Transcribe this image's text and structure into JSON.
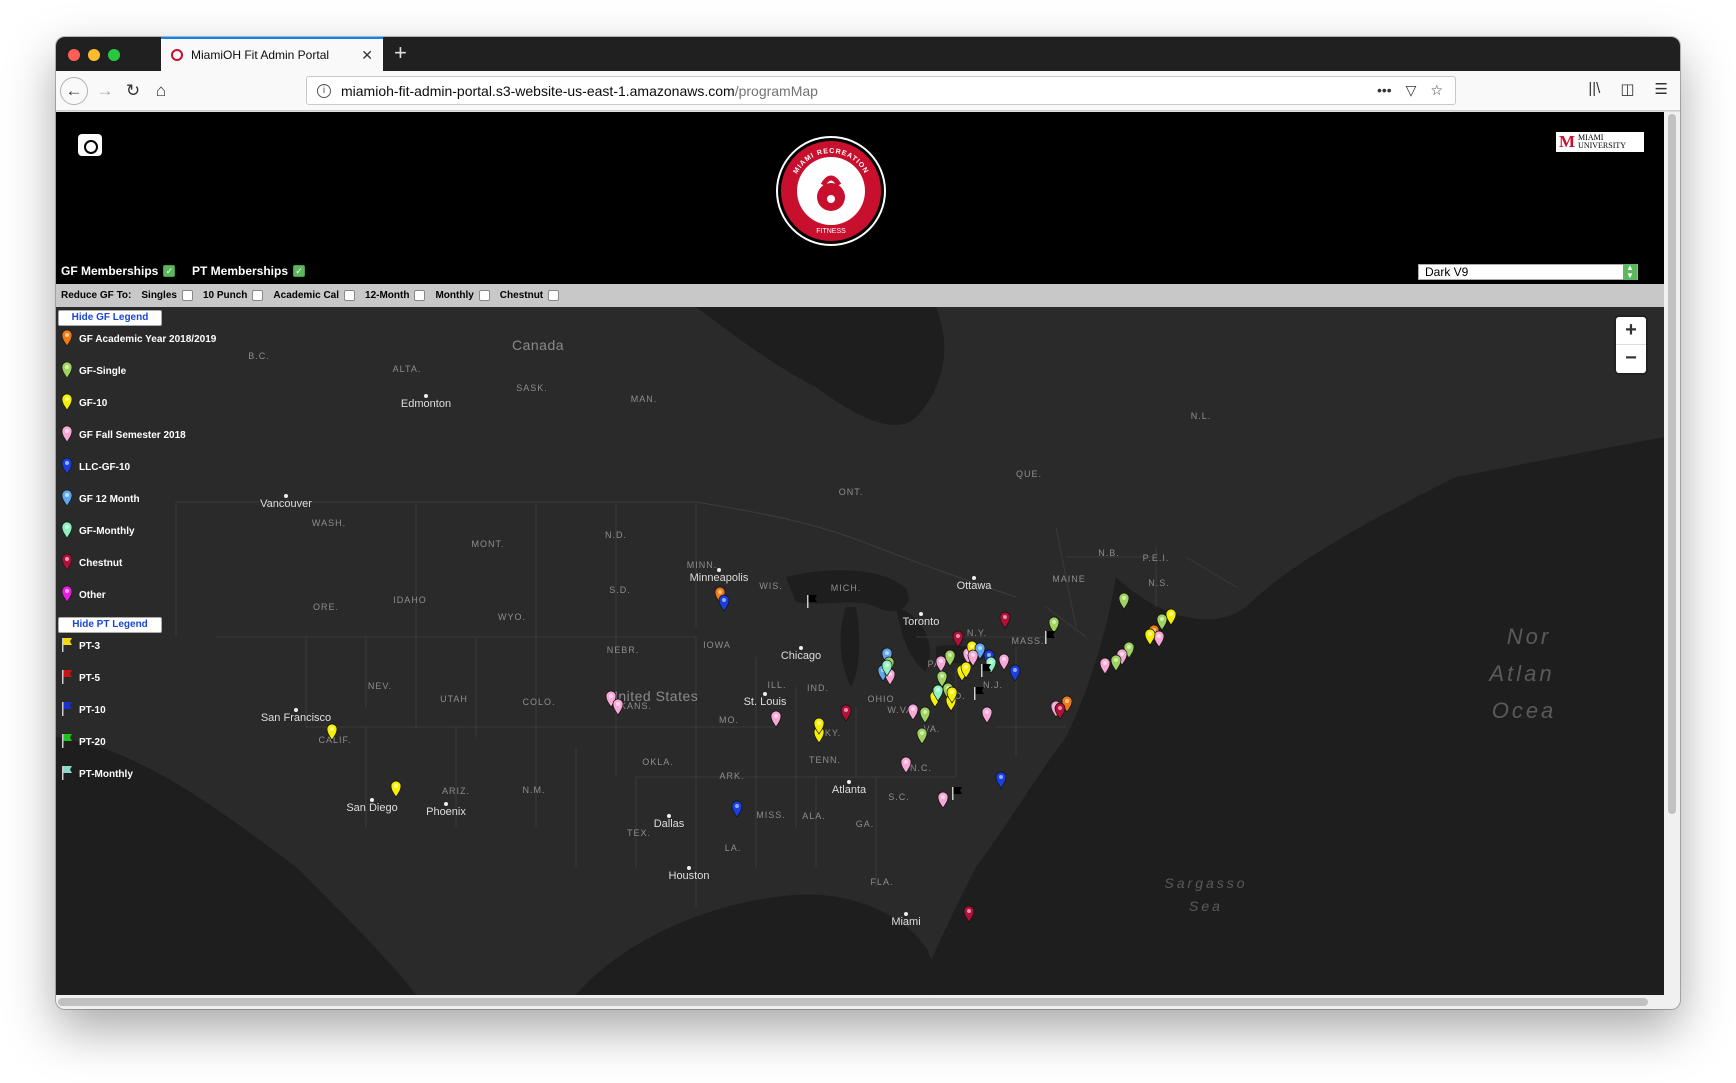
{
  "browser": {
    "tab_title": "MiamiOH Fit Admin Portal",
    "url_host": "miamioh-fit-admin-portal.s3-website-us-east-1.amazonaws.com",
    "url_path": "/programMap"
  },
  "header": {
    "logo_ring_text": "MIAMI RECREATION",
    "logo_bottom_text": "FITNESS",
    "university_logo_letter": "M",
    "university_logo_text": "MIAMI UNIVERSITY",
    "gf_memberships_label": "GF Memberships",
    "pt_memberships_label": "PT Memberships",
    "map_style_selected": "Dark V9"
  },
  "reduce_bar": {
    "label": "Reduce GF To:",
    "options": [
      "Singles",
      "10 Punch",
      "Academic Cal",
      "12-Month",
      "Monthly",
      "Chestnut"
    ]
  },
  "legend": {
    "hide_gf_label": "Hide GF Legend",
    "hide_pt_label": "Hide PT Legend",
    "gf_items": [
      {
        "label": "GF Academic Year 2018/2019",
        "color": "#f07b12"
      },
      {
        "label": "GF-Single",
        "color": "#9ed35f"
      },
      {
        "label": "GF-10",
        "color": "#f6f000"
      },
      {
        "label": "GF Fall Semester 2018",
        "color": "#f7a8d6"
      },
      {
        "label": "LLC-GF-10",
        "color": "#1a3fe0"
      },
      {
        "label": "GF 12 Month",
        "color": "#5fa8f0"
      },
      {
        "label": "GF-Monthly",
        "color": "#8ff0c0"
      },
      {
        "label": "Chestnut",
        "color": "#b0103a"
      },
      {
        "label": "Other",
        "color": "#e81ee0"
      }
    ],
    "pt_items": [
      {
        "label": "PT-3",
        "color": "#f5d90a"
      },
      {
        "label": "PT-5",
        "color": "#c81414"
      },
      {
        "label": "PT-10",
        "color": "#1a2fd0"
      },
      {
        "label": "PT-20",
        "color": "#1fc21f"
      },
      {
        "label": "PT-Monthly",
        "color": "#8fd8c8"
      }
    ]
  },
  "zoom": {
    "in": "+",
    "out": "−"
  },
  "map_labels": {
    "countries": [
      "Canada",
      "United States"
    ],
    "oceans": [
      "Nor",
      "Atlan",
      "Ocea",
      "Sargasso",
      "Sea"
    ],
    "regions": [
      "B.C.",
      "ALTA.",
      "SASK.",
      "MAN.",
      "ONT.",
      "QUE.",
      "N.L.",
      "N.B.",
      "P.E.I.",
      "N.S.",
      "WASH.",
      "MONT.",
      "N.D.",
      "S.D.",
      "MINN.",
      "WIS.",
      "MICH.",
      "MAINE",
      "ORE.",
      "IDAHO",
      "WYO.",
      "NEBR.",
      "IOWA",
      "N.Y.",
      "MASS.",
      "PA.",
      "NEV.",
      "UTAH",
      "COLO.",
      "ILL.",
      "IND.",
      "OHIO",
      "W.VA.",
      "VA.",
      "MD.",
      "N.J.",
      "CALIF.",
      "KANS.",
      "MO.",
      "KY.",
      "TENN.",
      "N.C.",
      "ARIZ.",
      "N.M.",
      "OKLA.",
      "ARK.",
      "S.C.",
      "MISS.",
      "ALA.",
      "GA.",
      "TEX.",
      "LA.",
      "FLA."
    ],
    "cities": [
      "Edmonton",
      "Vancouver",
      "Minneapolis",
      "Ottawa",
      "Toronto",
      "Chicago",
      "St. Louis",
      "San Francisco",
      "San Diego",
      "Phoenix",
      "Dallas",
      "Houston",
      "Atlanta",
      "Miami"
    ]
  }
}
